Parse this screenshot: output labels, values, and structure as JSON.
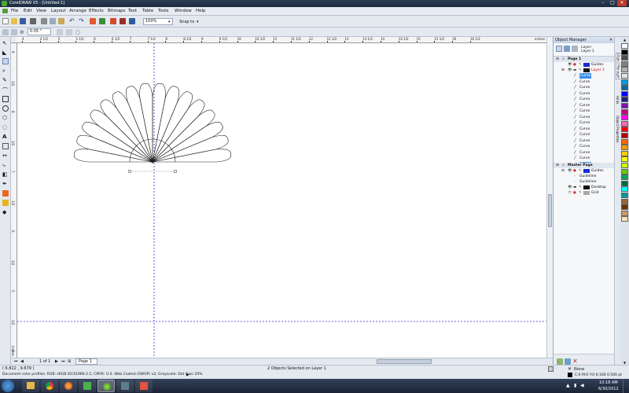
{
  "window": {
    "title": "CorelDRAW X5 - [Untitled-1]",
    "minimize": "–",
    "maximize": "□",
    "close": "✕"
  },
  "menu": [
    "File",
    "Edit",
    "View",
    "Layout",
    "Arrange",
    "Effects",
    "Bitmaps",
    "Text",
    "Table",
    "Tools",
    "Window",
    "Help"
  ],
  "toolbar": {
    "zoom_value": "150%",
    "snap_label": "Snap to",
    "nudge_value": "0.05 \""
  },
  "ruler": {
    "h_ticks": [
      "4",
      "4 1/2",
      "5",
      "5 1/2",
      "6",
      "6 1/2",
      "7",
      "7 1/2",
      "8",
      "8 1/2",
      "9",
      "9 1/2",
      "10",
      "10 1/2",
      "11",
      "11 1/2",
      "12",
      "12 1/2",
      "13",
      "13 1/2",
      "14",
      "14 1/2",
      "15",
      "15 1/2",
      "16",
      "16 1/2"
    ],
    "h_unit": "inches",
    "v_ticks": [
      "9",
      "1/2",
      "8",
      "1/2",
      "7",
      "1/2",
      "6",
      "1/2",
      "5",
      "1/2",
      "4"
    ],
    "v_unit": "inches"
  },
  "object_manager": {
    "title": "Object Manager",
    "layer_label": "Layer:",
    "layer_name": "Layer 1",
    "page1": "Page 1",
    "guides": "Guides",
    "layer1": "Layer 1",
    "curves": [
      "Curve",
      "Curve",
      "Curve",
      "Curve",
      "Curve",
      "Curve",
      "Curve",
      "Curve",
      "Curve",
      "Curve",
      "Curve",
      "Curve",
      "Curve",
      "Curve",
      "Curve",
      "Curve"
    ],
    "master_page": "Master Page",
    "master_guides": "Guides",
    "guideline1": "Guideline",
    "guideline2": "Guideline",
    "desktop": "Desktop",
    "grid": "Grid"
  },
  "docker_tabs": [
    "Object Manager",
    "Hints",
    "Object Properties"
  ],
  "palette": [
    "#ffffff",
    "#000000",
    "#4d4d4d",
    "#808080",
    "#b3b3b3",
    "#e6e6e6",
    "#00a0e3",
    "#00699d",
    "#0000ff",
    "#1a237e",
    "#7d0fb6",
    "#c2007a",
    "#ff00ff",
    "#ff66b3",
    "#ff0000",
    "#b30000",
    "#ff6600",
    "#ff9900",
    "#ffcc00",
    "#ffff00",
    "#ccff00",
    "#66cc00",
    "#00a651",
    "#006837",
    "#00ffff",
    "#009999",
    "#996633",
    "#663300",
    "#cc9966",
    "#ffe0b3"
  ],
  "page_nav": {
    "counter": "1 of 1",
    "tab": "Page 1"
  },
  "status": {
    "coords": "( 6.822 , 9.679 )",
    "selection": "2 Objects Selected on Layer 1",
    "profile": "Document color profiles: RGB: sRGB IEC61966-2.1; CMYK: U.S. Web Coated (SWOP) v2; Grayscale: Dot Gain 20%",
    "fill_label": "None",
    "outline_label": "C:0 M:0 Y:0 K:100  0.500 pt"
  },
  "clock": {
    "time": "10:18 AM",
    "date": "6/30/2012"
  },
  "colors": {
    "guide": "#3333cc",
    "selection": "#3a8ee6",
    "layer_red": "#dd0000"
  }
}
